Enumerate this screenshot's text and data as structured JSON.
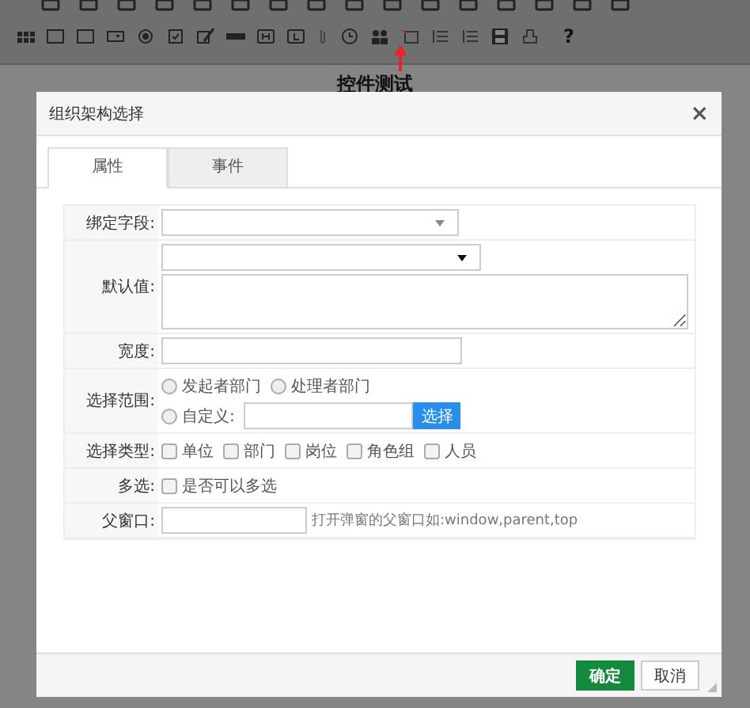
{
  "editor": {
    "help": "?",
    "document_title": "控件测试"
  },
  "dialog": {
    "title": "组织架构选择",
    "close": "×",
    "tabs": [
      {
        "label": "属性",
        "selected": true
      },
      {
        "label": "事件",
        "selected": false
      }
    ],
    "fields": [
      {
        "kind": "select",
        "label": "绑定字段:"
      },
      {
        "kind": "select_textarea",
        "label": "默认值:"
      },
      {
        "kind": "text",
        "label": "宽度:"
      },
      {
        "kind": "scope",
        "label": "选择范围:",
        "options": [
          {
            "label": "发起者部门",
            "selected": false
          },
          {
            "label": "处理者部门",
            "selected": false
          }
        ],
        "custom": {
          "label": "自定义:",
          "selected": false,
          "button": "选择"
        }
      },
      {
        "kind": "checkboxes",
        "label": "选择类型:",
        "options": [
          {
            "label": "单位",
            "checked": false
          },
          {
            "label": "部门",
            "checked": false
          },
          {
            "label": "岗位",
            "checked": false
          },
          {
            "label": "角色组",
            "checked": false
          },
          {
            "label": "人员",
            "checked": false
          }
        ]
      },
      {
        "kind": "checkboxes",
        "label": "多选:",
        "options": [
          {
            "label": "是否可以多选",
            "checked": false
          }
        ]
      },
      {
        "kind": "text_hint",
        "label": "父窗口:",
        "hint": "打开弹窗的父窗口如:window,parent,top"
      }
    ],
    "buttons": [
      {
        "label": "确定",
        "kind": "primary"
      },
      {
        "label": "取消",
        "kind": "default"
      }
    ]
  }
}
